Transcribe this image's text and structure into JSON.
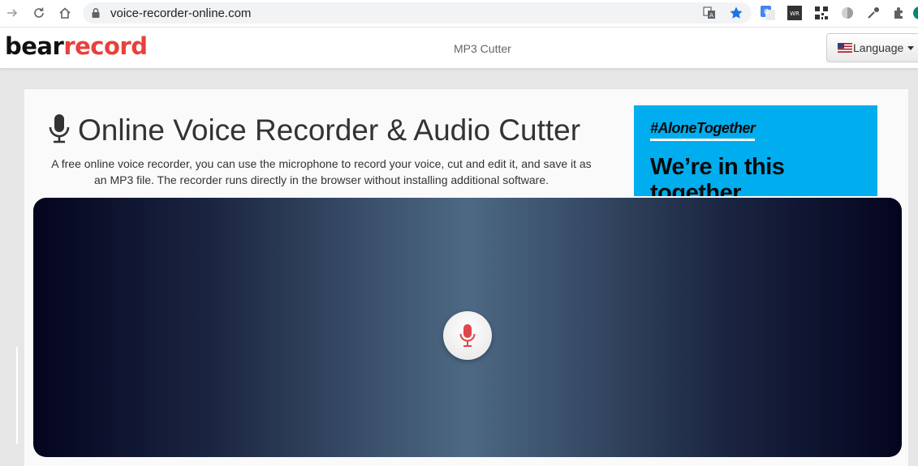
{
  "browser": {
    "url": "voice-recorder-online.com"
  },
  "header": {
    "logo_part1": "bear",
    "logo_part2": "record",
    "mp3_link": "MP3 Cutter",
    "language_button": "Language"
  },
  "main": {
    "title": "Online Voice Recorder & Audio Cutter",
    "description": "A free online voice recorder, you can use the microphone to record your voice, cut and edit it, and save it as an MP3 file. The recorder runs directly in the browser without installing additional software."
  },
  "ad": {
    "hashtag": "#AloneTogether",
    "headline": "We’re in this together"
  },
  "colors": {
    "brand_red": "#e8403a",
    "ad_blue": "#00aeef",
    "mic_red": "#e0474c"
  }
}
